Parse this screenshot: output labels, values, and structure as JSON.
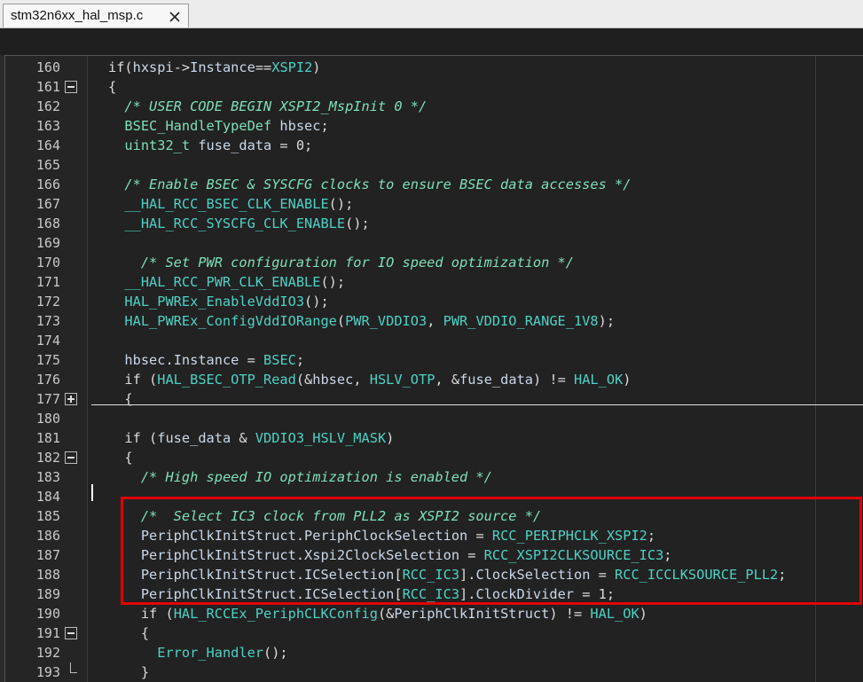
{
  "tab": {
    "label": "stm32n6xx_hal_msp.c",
    "close_icon": "close-icon"
  },
  "lines": [
    {
      "num": "160",
      "fold": "",
      "html": "<span class=\"kw\">if</span>(<span class=\"id\">hxspi</span>-><span class=\"id\">Instance</span>==<span class=\"mc\">XSPI2</span>)"
    },
    {
      "num": "161",
      "fold": "minus",
      "html": "{"
    },
    {
      "num": "162",
      "fold": "",
      "html": "  <span class=\"cm\">/* USER CODE BEGIN XSPI2_MspInit 0 */</span>"
    },
    {
      "num": "163",
      "fold": "",
      "html": "  <span class=\"ty\">BSEC_HandleTypeDef</span> <span class=\"id\">hbsec</span>;"
    },
    {
      "num": "164",
      "fold": "",
      "html": "  <span class=\"ty\">uint32_t</span> <span class=\"id\">fuse_data</span> = 0;"
    },
    {
      "num": "165",
      "fold": "",
      "html": ""
    },
    {
      "num": "166",
      "fold": "",
      "html": "  <span class=\"cm\">/* Enable BSEC &amp; SYSCFG clocks to ensure BSEC data accesses */</span>"
    },
    {
      "num": "167",
      "fold": "",
      "html": "  <span class=\"mc\">__HAL_RCC_BSEC_CLK_ENABLE</span>();"
    },
    {
      "num": "168",
      "fold": "",
      "html": "  <span class=\"mc\">__HAL_RCC_SYSCFG_CLK_ENABLE</span>();"
    },
    {
      "num": "169",
      "fold": "",
      "html": ""
    },
    {
      "num": "170",
      "fold": "",
      "html": "    <span class=\"cm\">/* Set PWR configuration for IO speed optimization */</span>"
    },
    {
      "num": "171",
      "fold": "",
      "html": "  <span class=\"mc\">__HAL_RCC_PWR_CLK_ENABLE</span>();"
    },
    {
      "num": "172",
      "fold": "",
      "html": "  <span class=\"mc\">HAL_PWREx_EnableVddIO3</span>();"
    },
    {
      "num": "173",
      "fold": "",
      "html": "  <span class=\"mc\">HAL_PWREx_ConfigVddIORange</span>(<span class=\"mc\">PWR_VDDIO3</span>, <span class=\"mc\">PWR_VDDIO_RANGE_1V8</span>);"
    },
    {
      "num": "174",
      "fold": "",
      "html": ""
    },
    {
      "num": "175",
      "fold": "",
      "html": "  <span class=\"id\">hbsec</span>.<span class=\"id\">Instance</span> = <span class=\"mc\">BSEC</span>;"
    },
    {
      "num": "176",
      "fold": "",
      "html": "  <span class=\"kw\">if</span> (<span class=\"mc\">HAL_BSEC_OTP_Read</span>(&amp;<span class=\"id\">hbsec</span>, <span class=\"mc\">HSLV_OTP</span>, &amp;<span class=\"id\">fuse_data</span>) != <span class=\"mc\">HAL_OK</span>)"
    },
    {
      "num": "177",
      "fold": "plus",
      "html": "  {"
    },
    {
      "num": "180",
      "fold": "",
      "html": ""
    },
    {
      "num": "181",
      "fold": "",
      "html": "  <span class=\"kw\">if</span> (<span class=\"id\">fuse_data</span> &amp; <span class=\"mc\">VDDIO3_HSLV_MASK</span>)"
    },
    {
      "num": "182",
      "fold": "minus",
      "html": "  {"
    },
    {
      "num": "183",
      "fold": "",
      "html": "    <span class=\"cm\">/* High speed IO optimization is enabled */</span>"
    },
    {
      "num": "184",
      "fold": "",
      "html": ""
    },
    {
      "num": "185",
      "fold": "",
      "html": "    <span class=\"cm\">/*  Select IC3 clock from PLL2 as XSPI2 source */</span>"
    },
    {
      "num": "186",
      "fold": "",
      "html": "    <span class=\"id\">PeriphClkInitStruct</span>.<span class=\"id\">PeriphClockSelection</span> = <span class=\"mc\">RCC_PERIPHCLK_XSPI2</span>;"
    },
    {
      "num": "187",
      "fold": "",
      "html": "    <span class=\"id\">PeriphClkInitStruct</span>.<span class=\"id\">Xspi2ClockSelection</span> = <span class=\"mc\">RCC_XSPI2CLKSOURCE_IC3</span>;"
    },
    {
      "num": "188",
      "fold": "",
      "html": "    <span class=\"id\">PeriphClkInitStruct</span>.<span class=\"id\">ICSelection</span>[<span class=\"mc\">RCC_IC3</span>].<span class=\"id\">ClockSelection</span> = <span class=\"mc\">RCC_ICCLKSOURCE_PLL2</span>;"
    },
    {
      "num": "189",
      "fold": "",
      "html": "    <span class=\"id\">PeriphClkInitStruct</span>.<span class=\"id\">ICSelection</span>[<span class=\"mc\">RCC_IC3</span>].<span class=\"id\">ClockDivider</span> = 1;"
    },
    {
      "num": "190",
      "fold": "",
      "html": "    <span class=\"kw\">if</span> (<span class=\"mc\">HAL_RCCEx_PeriphCLKConfig</span>(&amp;<span class=\"id\">PeriphClkInitStruct</span>) != <span class=\"mc\">HAL_OK</span>)"
    },
    {
      "num": "191",
      "fold": "minus",
      "html": "    {"
    },
    {
      "num": "192",
      "fold": "",
      "html": "      <span class=\"mc\">Error_Handler</span>();"
    },
    {
      "num": "193",
      "fold": "end",
      "html": "    }"
    }
  ],
  "colors": {
    "highlight": "#e00000",
    "background": "#222222"
  }
}
